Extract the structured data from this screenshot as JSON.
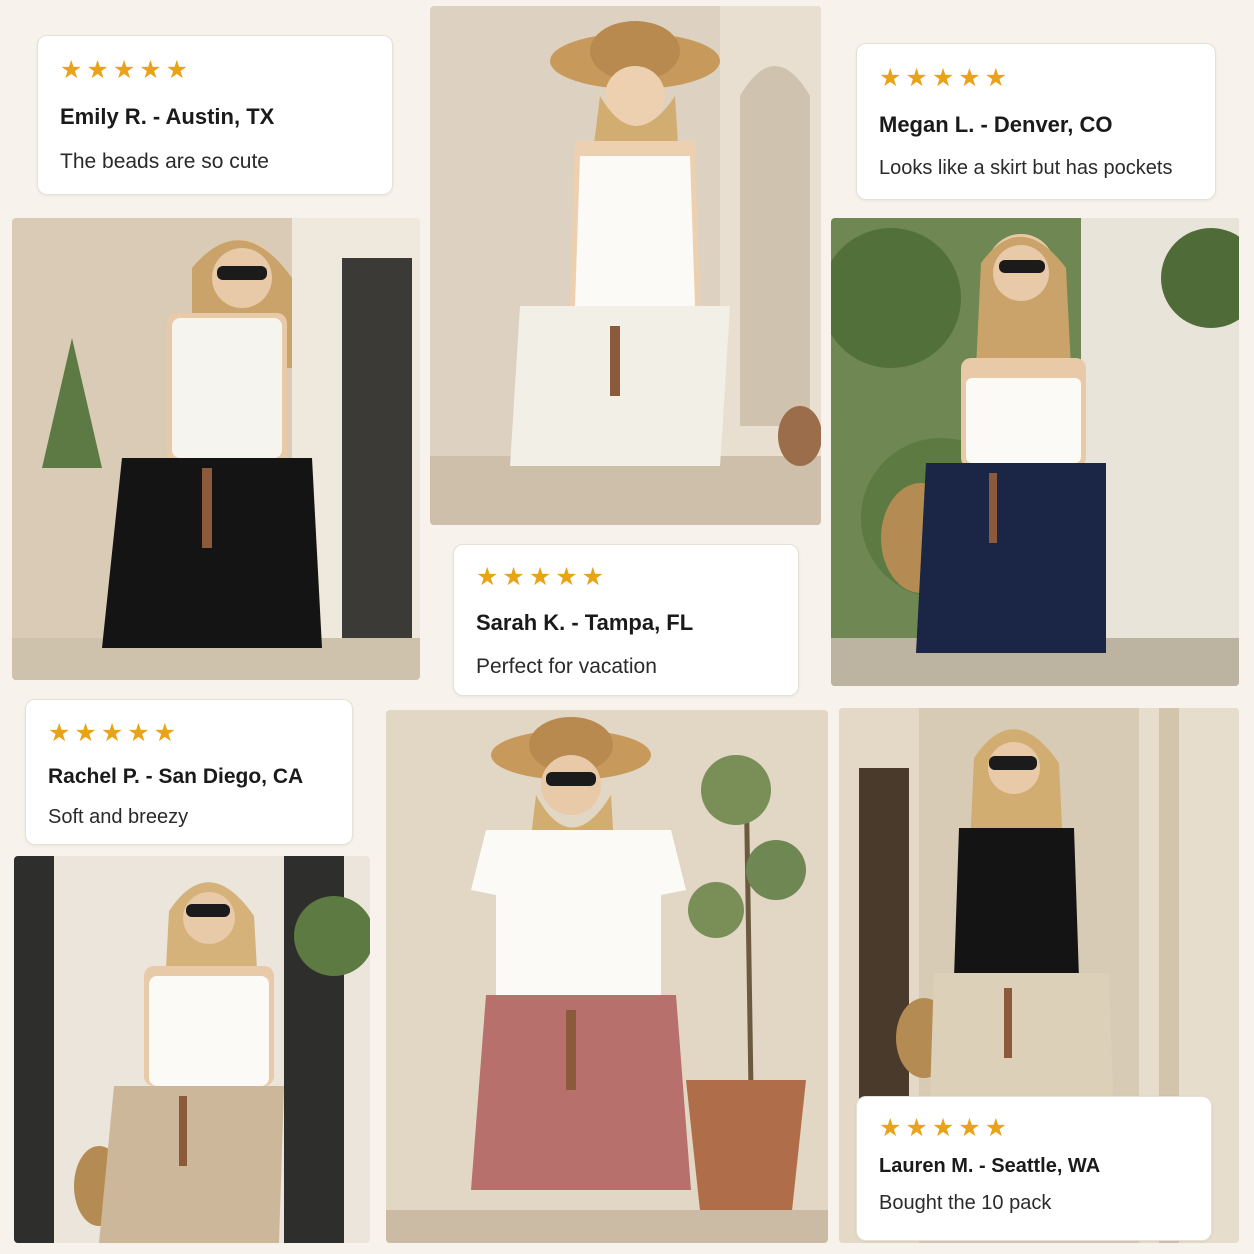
{
  "colors": {
    "background": "#f7f3ec",
    "star": "#e8a317",
    "card_bg": "#ffffff"
  },
  "reviews": [
    {
      "stars": "★★★★★",
      "rating": 5,
      "name": "Emily R. - Austin, TX",
      "quote": "The beads are so cute"
    },
    {
      "stars": "★★★★★",
      "rating": 5,
      "name": "Megan L. - Denver, CO",
      "quote": "Looks like a skirt but has pockets"
    },
    {
      "stars": "★★★★★",
      "rating": 5,
      "name": "Sarah K. - Tampa, FL",
      "quote": "Perfect for vacation"
    },
    {
      "stars": "★★★★★",
      "rating": 5,
      "name": "Rachel P. - San Diego, CA",
      "quote": "Soft and breezy"
    },
    {
      "stars": "★★★★★",
      "rating": 5,
      "name": "Lauren M. - Seattle, WA",
      "quote": "Bought the 10 pack"
    }
  ],
  "photos": [
    {
      "icon": "model-photo",
      "top": "white tank",
      "shorts": "black",
      "shorts_color": "#141414"
    },
    {
      "icon": "model-photo",
      "top": "white tank",
      "shorts": "white",
      "shorts_color": "#f2efe6"
    },
    {
      "icon": "model-photo",
      "top": "white tube",
      "shorts": "navy",
      "shorts_color": "#1b2545"
    },
    {
      "icon": "model-photo",
      "top": "white tank",
      "shorts": "khaki",
      "shorts_color": "#cdb79a"
    },
    {
      "icon": "model-photo",
      "top": "white tee",
      "shorts": "dusty rose",
      "shorts_color": "#b8706c"
    },
    {
      "icon": "model-photo",
      "top": "black tank",
      "shorts": "beige",
      "shorts_color": "#ddd0b8"
    }
  ]
}
